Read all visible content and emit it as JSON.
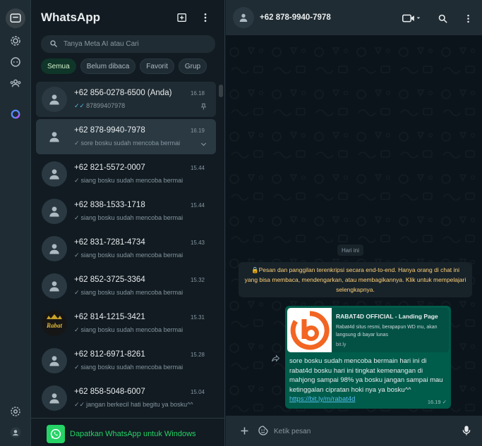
{
  "rail": {
    "items": [
      {
        "icon": "chats-icon",
        "active": true
      },
      {
        "icon": "status-icon",
        "active": false
      },
      {
        "icon": "channels-icon",
        "active": false
      },
      {
        "icon": "communities-icon",
        "active": false
      },
      {
        "icon": "meta-ai-icon",
        "active": false
      }
    ],
    "bottom": [
      {
        "icon": "settings-icon"
      },
      {
        "icon": "profile-icon"
      }
    ]
  },
  "sidebar": {
    "title": "WhatsApp",
    "search_placeholder": "Tanya Meta AI atau Cari",
    "filters": [
      {
        "label": "Semua",
        "active": true
      },
      {
        "label": "Belum dibaca",
        "active": false
      },
      {
        "label": "Favorit",
        "active": false
      },
      {
        "label": "Grup",
        "active": false
      }
    ],
    "chats": [
      {
        "name": "+62 856-0278-6500 (Anda)",
        "time": "16.18",
        "preview": "87899407978",
        "tick": "double-blue",
        "pinned": true
      },
      {
        "name": "+62 878-9940-7978",
        "time": "16.19",
        "preview": "sore   bosku sudah mencoba bermai",
        "tick": "single",
        "selected": true
      },
      {
        "name": "+62 821-5572-0007",
        "time": "15.44",
        "preview": "siang  bosku sudah mencoba bermai",
        "tick": "single"
      },
      {
        "name": "+62 838-1533-1718",
        "time": "15.44",
        "preview": "siang  bosku sudah mencoba bermai",
        "tick": "single"
      },
      {
        "name": "+62 831-7281-4734",
        "time": "15.43",
        "preview": "siang  bosku sudah mencoba bermai",
        "tick": "single"
      },
      {
        "name": "+62 852-3725-3364",
        "time": "15.32",
        "preview": "siang  bosku sudah mencoba bermai",
        "tick": "single"
      },
      {
        "name": "+62 814-1215-3421",
        "time": "15.31",
        "preview": "siang  bosku sudah mencoba bermai",
        "tick": "single",
        "avatar_text": "Rabat"
      },
      {
        "name": "+62 812-6971-8261",
        "time": "15.28",
        "preview": "siang  bosku sudah mencoba bermai",
        "tick": "single"
      },
      {
        "name": "+62 858-5048-6007",
        "time": "15.04",
        "preview": "jangan berkecil hati begitu ya bosku^^",
        "tick": "double"
      }
    ],
    "promo": "Dapatkan WhatsApp untuk Windows"
  },
  "conversation": {
    "title": "+62 878-9940-7978",
    "date_label": "Hari ini",
    "e2e_notice": "Pesan dan panggilan terenkripsi secara end-to-end. Hanya orang di chat ini yang bisa membaca, mendengarkan, atau membagikannya. Klik untuk mempelajari selengkapnya.",
    "message": {
      "link_title": "RABAT4D OFFICIAL - Landing Page",
      "link_desc": "Rabat4d situs resmi, berapapun WD mu, akan langsung di bayar lunas",
      "link_domain": "bit.ly",
      "text": "sore   bosku sudah mencoba bermain hari ini di rabat4d bosku hari ini tingkat kemenangan di mahjong sampai 98% ya bosku jangan sampai mau ketinggalan cipratan hoki nya ya bosku^^",
      "url": "https://bit.ly/m/rabat4d",
      "time": "16.19"
    },
    "composer_placeholder": "Ketik pesan"
  },
  "colors": {
    "accent": "#25d366",
    "bubble_out": "#005c4b",
    "panel": "#202c33",
    "background": "#0b141a"
  }
}
